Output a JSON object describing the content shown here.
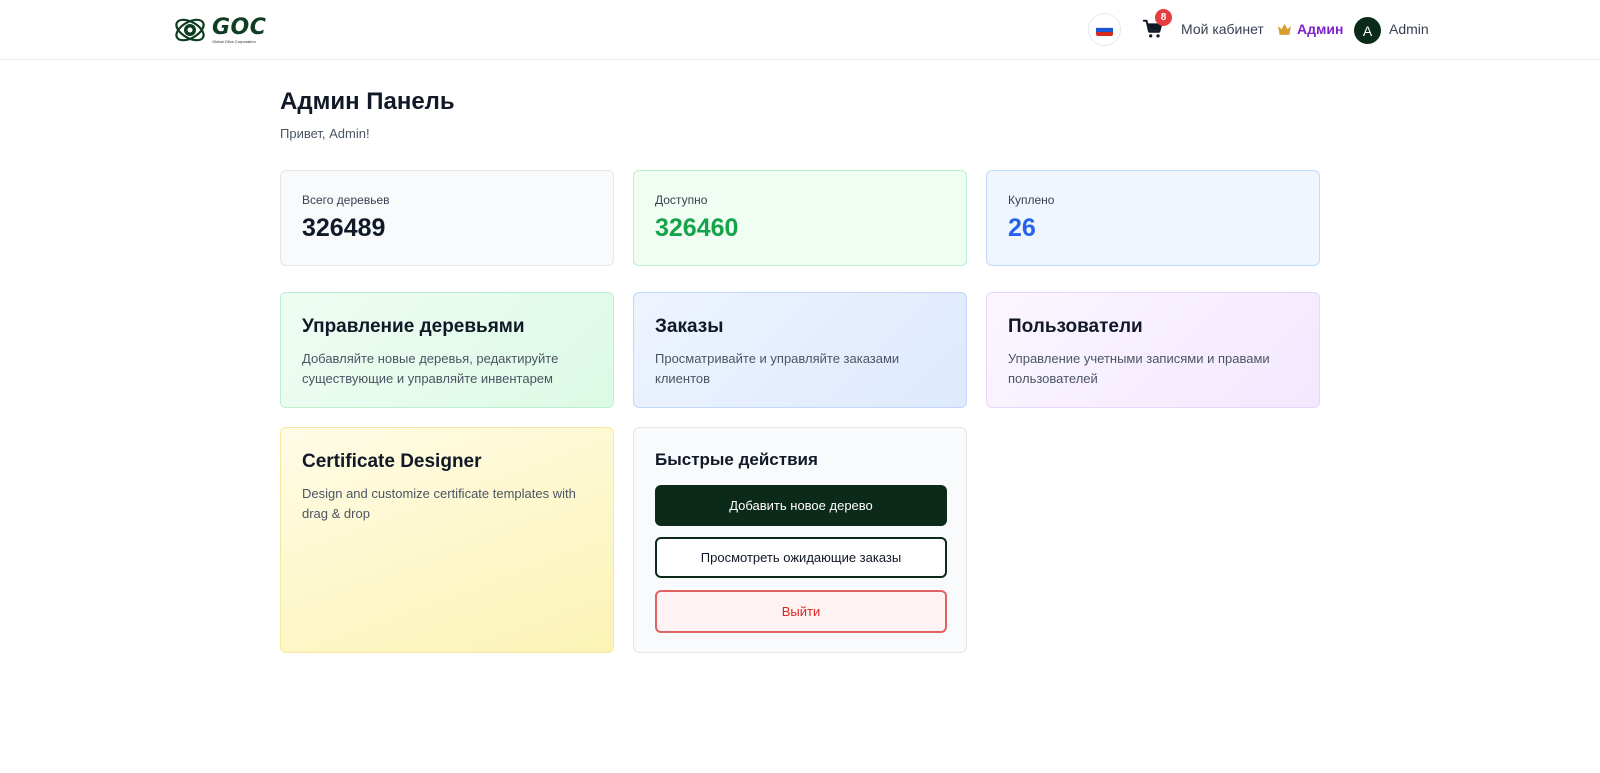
{
  "header": {
    "logo": {
      "word": "GOC",
      "subtitle": "Global Olive Corporation"
    },
    "language": {
      "flag": "ru-flag-icon"
    },
    "cart": {
      "count": "8"
    },
    "cabinet_label": "Мой кабинет",
    "admin_label": "Админ",
    "avatar_initial": "A",
    "user_name": "Admin"
  },
  "page": {
    "title": "Админ Панель",
    "greeting": "Привет, Admin!"
  },
  "stats": [
    {
      "label": "Всего деревьев",
      "value": "326489",
      "color": "#111827"
    },
    {
      "label": "Доступно",
      "value": "326460",
      "color": "#16a34a"
    },
    {
      "label": "Куплено",
      "value": "26",
      "color": "#2563eb"
    }
  ],
  "features": [
    {
      "title": "Управление деревьями",
      "desc": "Добавляйте новые деревья, редактируйте существующие и управляйте инвентарем"
    },
    {
      "title": "Заказы",
      "desc": "Просматривайте и управляйте заказами клиентов"
    },
    {
      "title": "Пользователи",
      "desc": "Управление учетными записями и правами пользователей"
    },
    {
      "title": "Certificate Designer",
      "desc": "Design and customize certificate templates with drag & drop"
    }
  ],
  "quick_actions": {
    "title": "Быстрые действия",
    "add_tree": "Добавить новое дерево",
    "view_pending": "Просмотреть ожидающие заказы",
    "logout": "Выйти"
  },
  "colors": {
    "brand_dark": "#0b2a1a",
    "admin_purple": "#7e22ce",
    "badge_red": "#e53e3e",
    "logout_red": "#dc2626"
  }
}
